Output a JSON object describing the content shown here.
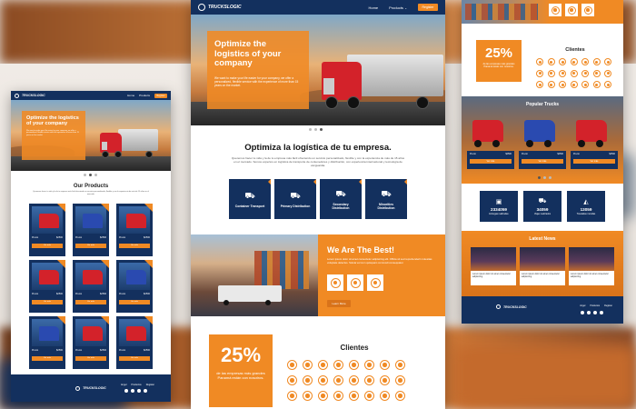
{
  "brand": {
    "name": "TRUCKSLOGIC",
    "accent": "#f08a24",
    "navy": "#13305e"
  },
  "nav": {
    "home": "Home",
    "products": "Products",
    "cta": "Register"
  },
  "hero": {
    "title": "Optimize the logistics of your company",
    "body": "We want to make your life easier for your company, we offer a personalized, flexible service with the experience of more than 15 years on the market."
  },
  "optimiza": {
    "title": "Optimiza la logística de tu empresa.",
    "body": "Queremos hacer tu vida y la de tu empresa más fácil ofreciendo un servicio personalizado, flexible y con la experiencia de más de 15 años en el mercado. Somos expertos en logística de transporte de contenedores y distribución, con experiencia internacional y tecnología de vanguardia."
  },
  "services": [
    {
      "icon": "truck-icon",
      "label": "Container Transport"
    },
    {
      "icon": "truck-icon",
      "label": "Primary Distribution"
    },
    {
      "icon": "truck-icon",
      "label": "Secondary Distribution"
    },
    {
      "icon": "truck-icon",
      "label": "Minorities Distribution"
    }
  ],
  "best": {
    "title": "We Are The Best!",
    "body": "Lorem ipsum dolor sit amet consectetur adipisicing elit. Officia sit sed reprehenderit molestias voluptate delectus. Soluta vel cum quisquam commodi consequatur.",
    "button": "Learn More"
  },
  "stats_banner": {
    "value": "25%",
    "text": "de las empresas más grandes Panamá están con nosotros."
  },
  "clientes": {
    "title": "Clientes"
  },
  "products": {
    "title": "Our Products",
    "subtitle": "Queremos hacer tu vida y la de tu empresa más fácil ofreciendo un servicio personalizado, flexible y con la experiencia de más de 15 años en el mercado.",
    "price_label": "Precio",
    "price_value": "$2500",
    "button": "Ver más"
  },
  "popular": {
    "title": "Popular Trucks"
  },
  "counters": [
    {
      "icon": "box-icon",
      "value": "2334059",
      "label": "Entregas realizadas"
    },
    {
      "icon": "truck-icon",
      "value": "34059",
      "label": "Viajes realizados"
    },
    {
      "icon": "bag-icon",
      "value": "13059",
      "label": "Toneladas movidas"
    }
  ],
  "news": {
    "title": "Latest News",
    "item": "Lorem ipsum dolor sit amet consectetur adipisicing"
  },
  "footer": {
    "links": [
      "Angel",
      "Productos",
      "Register"
    ]
  }
}
